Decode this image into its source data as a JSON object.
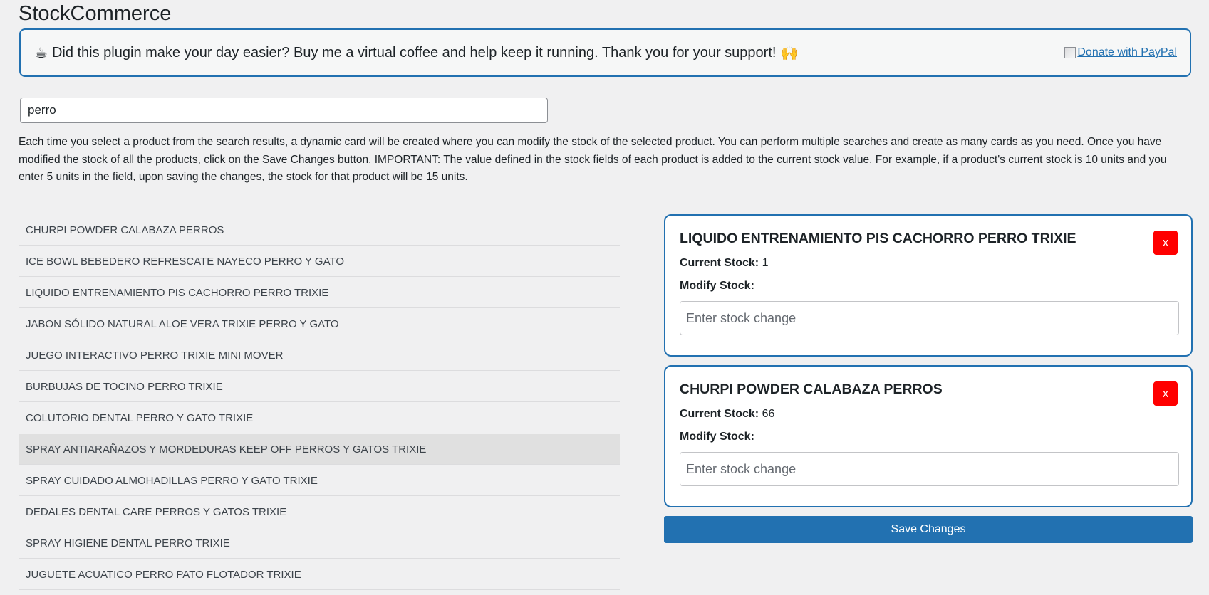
{
  "page": {
    "title": "StockCommerce"
  },
  "banner": {
    "coffee_icon": "☕",
    "text": "Did this plugin make your day easier? Buy me a virtual coffee and help keep it running. Thank you for your support!",
    "hands_icon": "🙌",
    "paypal_link": "Donate with PayPal"
  },
  "search": {
    "value": "perro"
  },
  "instructions": "Each time you select a product from the search results, a dynamic card will be created where you can modify the stock of the selected product. You can perform multiple searches and create as many cards as you need. Once you have modified the stock of all the products, click on the Save Changes button. IMPORTANT: The value defined in the stock fields of each product is added to the current stock value. For example, if a product's current stock is 10 units and you enter 5 units in the field, upon saving the changes, the stock for that product will be 15 units.",
  "results": [
    {
      "label": "CHURPI POWDER CALABAZA PERROS"
    },
    {
      "label": "ICE BOWL BEBEDERO REFRESCATE NAYECO PERRO Y GATO"
    },
    {
      "label": "LIQUIDO ENTRENAMIENTO PIS CACHORRO PERRO TRIXIE"
    },
    {
      "label": "JABON SÓLIDO NATURAL ALOE VERA TRIXIE PERRO Y GATO"
    },
    {
      "label": "JUEGO INTERACTIVO PERRO TRIXIE MINI MOVER"
    },
    {
      "label": "BURBUJAS DE TOCINO PERRO TRIXIE"
    },
    {
      "label": "COLUTORIO DENTAL PERRO Y GATO TRIXIE"
    },
    {
      "label": "SPRAY ANTIARAÑAZOS Y MORDEDURAS KEEP OFF PERROS Y GATOS TRIXIE"
    },
    {
      "label": "SPRAY CUIDADO ALMOHADILLAS PERRO Y GATO TRIXIE"
    },
    {
      "label": "DEDALES DENTAL CARE PERROS Y GATOS TRIXIE"
    },
    {
      "label": "SPRAY HIGIENE DENTAL PERRO TRIXIE"
    },
    {
      "label": "JUGUETE ACUATICO PERRO PATO FLOTADOR TRIXIE"
    }
  ],
  "highlighted_result_index": 7,
  "cards": [
    {
      "title": "LIQUIDO ENTRENAMIENTO PIS CACHORRO PERRO TRIXIE",
      "remove_label": "x",
      "current_stock_label": "Current Stock:",
      "current_stock_value": "1",
      "modify_label": "Modify Stock:",
      "input_placeholder": "Enter stock change"
    },
    {
      "title": "CHURPI POWDER CALABAZA PERROS",
      "remove_label": "x",
      "current_stock_label": "Current Stock:",
      "current_stock_value": "66",
      "modify_label": "Modify Stock:",
      "input_placeholder": "Enter stock change"
    }
  ],
  "save_button": "Save Changes",
  "colors": {
    "accent": "#2271b1",
    "remove": "#ff0000",
    "background": "#f0f0f1",
    "highlight": "#e0e0e0"
  }
}
